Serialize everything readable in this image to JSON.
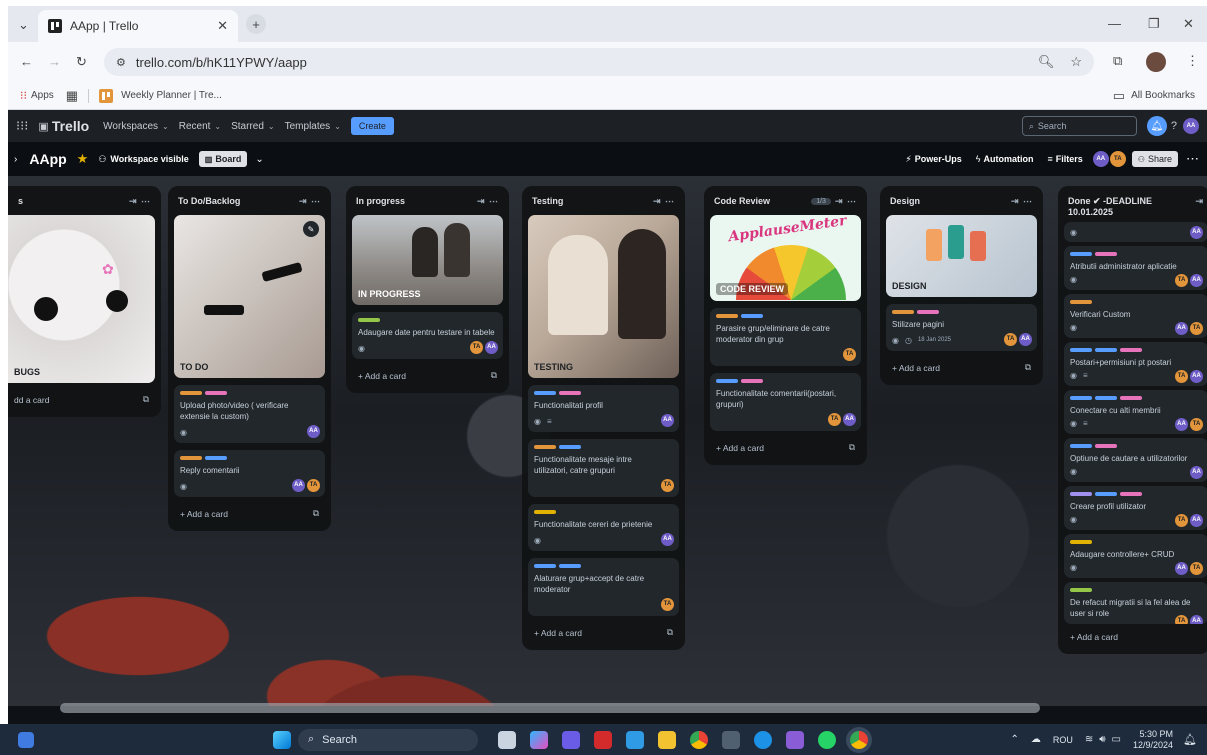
{
  "browser": {
    "tab_title": "AApp | Trello",
    "url": "trello.com/b/hK11YPWY/aapp",
    "bookmarks": {
      "apps": "Apps",
      "weekly": "Weekly Planner | Tre...",
      "all": "All Bookmarks"
    }
  },
  "trello_header": {
    "logo": "Trello",
    "nav": [
      "Workspaces",
      "Recent",
      "Starred",
      "Templates"
    ],
    "create": "Create",
    "search_placeholder": "Search",
    "user_initials": "AA"
  },
  "board_header": {
    "name": "AApp",
    "visibility": "Workspace visible",
    "view": "Board",
    "powerups": "Power-Ups",
    "automation": "Automation",
    "filters": "Filters",
    "share": "Share",
    "members": [
      "AA",
      "TA"
    ]
  },
  "lists": [
    {
      "name": "s",
      "cover_label": "BUGS",
      "add": "dd a card"
    },
    {
      "name": "To Do/Backlog",
      "cover_label": "TO DO",
      "cards": [
        {
          "title": "Upload photo/video ( verificare extensie la custom)",
          "labels": [
            "#e2953a",
            "#e774bb"
          ],
          "members": [
            "AA"
          ]
        },
        {
          "title": "Reply comentarii",
          "labels": [
            "#e2953a",
            "#579dff"
          ],
          "members": [
            "AA",
            "TA"
          ]
        }
      ],
      "add": "Add a card"
    },
    {
      "name": "In progress",
      "cover_label": "IN PROGRESS",
      "cards": [
        {
          "title": "Adaugare date pentru testare in tabele",
          "labels": [
            "#94c748"
          ],
          "members": [
            "TA",
            "AA"
          ]
        }
      ],
      "add": "Add a card"
    },
    {
      "name": "Testing",
      "cover_label": "TESTING",
      "cards": [
        {
          "title": "Functionalitati profil",
          "labels": [
            "#579dff",
            "#e774bb"
          ],
          "members": [
            "AA"
          ]
        },
        {
          "title": "Functionalitate mesaje intre utilizatori, catre grupuri",
          "labels": [
            "#e2953a",
            "#579dff"
          ],
          "members": [
            "TA"
          ]
        },
        {
          "title": "Functionalitate cereri de prietenie",
          "labels": [
            "#e2b203"
          ],
          "members": [
            "AA"
          ]
        },
        {
          "title": "Alaturare grup+accept de catre moderator",
          "labels": [
            "#579dff",
            "#579dff"
          ],
          "members": [
            "TA"
          ]
        }
      ],
      "add": "Add a card"
    },
    {
      "name": "Code Review",
      "count": "1/3",
      "cover_label": "CODE REVIEW",
      "cover_text": "ApplauseMeter",
      "cards": [
        {
          "title": "Parasire grup/eliminare de catre moderator din grup",
          "labels": [
            "#e2953a",
            "#579dff"
          ],
          "members": [
            "TA"
          ]
        },
        {
          "title": "Functionalitate comentarii(postari, grupuri)",
          "labels": [
            "#579dff",
            "#e774bb"
          ],
          "members": [
            "TA",
            "AA"
          ]
        }
      ],
      "add": "Add a card"
    },
    {
      "name": "Design",
      "cover_label": "DESIGN",
      "cards": [
        {
          "title": "Stilizare pagini",
          "labels": [
            "#e2953a",
            "#e774bb"
          ],
          "date": "18 Jan 2025",
          "members": [
            "TA",
            "AA"
          ]
        }
      ],
      "add": "Add a card"
    },
    {
      "name": "Done ✔ -DEADLINE 10.01.2025",
      "cards": [
        {
          "title": "",
          "labels": [],
          "members": [
            "AA"
          ]
        },
        {
          "title": "Atributii administrator aplicatie",
          "labels": [
            "#579dff",
            "#e774bb"
          ],
          "members": [
            "TA",
            "AA"
          ]
        },
        {
          "title": "Verificari Custom",
          "labels": [
            "#e2953a"
          ],
          "members": [
            "AA",
            "TA"
          ]
        },
        {
          "title": "Postari+permisiuni pt postari",
          "labels": [
            "#579dff",
            "#579dff",
            "#e774bb"
          ],
          "members": [
            "TA",
            "AA"
          ]
        },
        {
          "title": "Conectare cu alti membrii",
          "labels": [
            "#579dff",
            "#579dff",
            "#e774bb"
          ],
          "members": [
            "AA",
            "TA"
          ]
        },
        {
          "title": "Optiune de cautare a utilizatorilor",
          "labels": [
            "#579dff",
            "#e774bb"
          ],
          "members": [
            "AA"
          ]
        },
        {
          "title": "Creare profil utilizator",
          "labels": [
            "#9f8fef",
            "#579dff",
            "#e774bb"
          ],
          "members": [
            "TA",
            "AA"
          ]
        },
        {
          "title": "Adaugare controllere+ CRUD",
          "labels": [
            "#e2b203"
          ],
          "members": [
            "AA",
            "TA"
          ]
        },
        {
          "title": "De refacut migratii si la fel alea de user si role",
          "labels": [
            "#94c748"
          ],
          "members": [
            "TA",
            "AA"
          ]
        }
      ],
      "add": "Add a card"
    }
  ],
  "taskbar": {
    "search": "Search",
    "lang": "ROU",
    "time": "5:30 PM",
    "date": "12/9/2024"
  }
}
